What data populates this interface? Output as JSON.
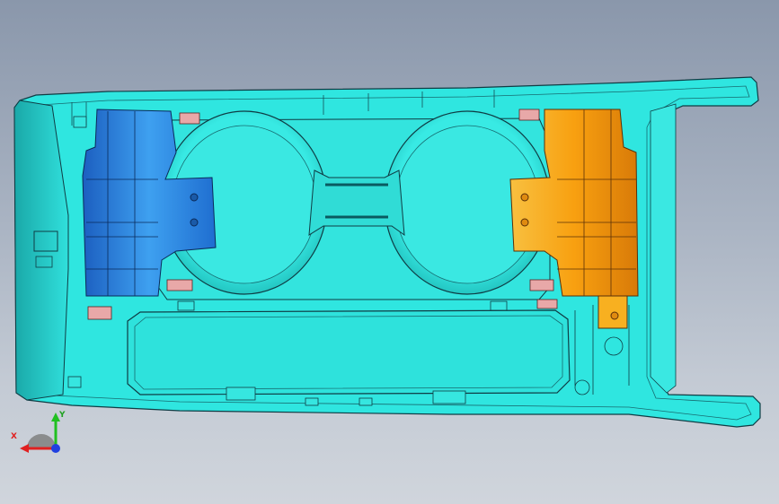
{
  "viewport": {
    "background_top": "#8a97ab",
    "background_bottom": "#d0d5dc"
  },
  "model": {
    "body_color": "#2fe6e0",
    "edge_color": "#0f3c44",
    "left_bracket_color": "#2f8de8",
    "right_bracket_color": "#f5a21a",
    "clip_color": "#e5a0a0"
  },
  "triad": {
    "x_label": "X",
    "y_label": "Y",
    "x_color": "#e02020",
    "y_color": "#20c020",
    "z_color": "#2040e0"
  }
}
